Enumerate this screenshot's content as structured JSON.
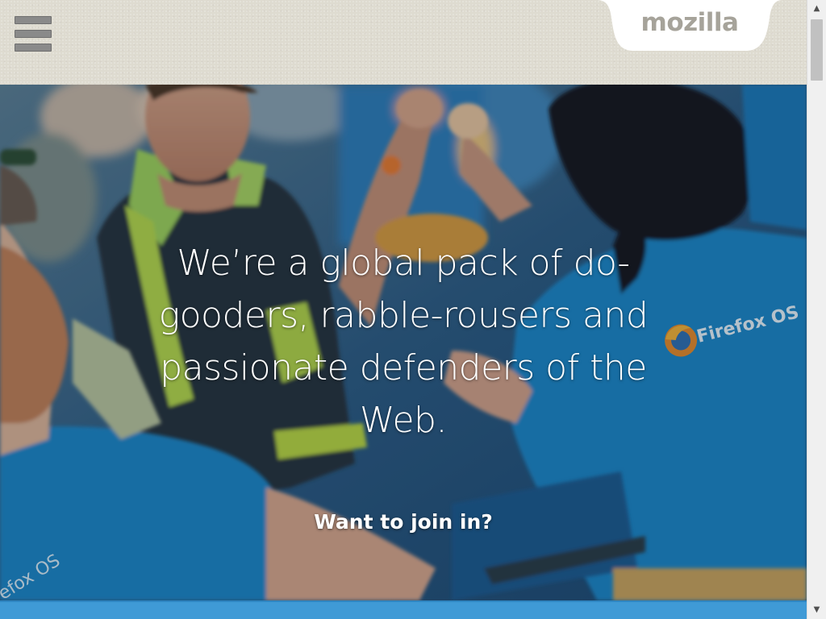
{
  "header": {
    "menu_icon": "hamburger-menu-icon",
    "logo_text": "mozilla"
  },
  "hero": {
    "headline": "We’re a global pack of do-gooders, rabble-rousers and passionate defenders of the Web.",
    "cta": "Want to join in?",
    "shirt_text_right": "Firefox OS",
    "shirt_text_left": "efox OS"
  },
  "scrollbar": {
    "up_icon": "scroll-up-arrow-icon",
    "down_icon": "scroll-down-arrow-icon",
    "position_fraction": 0.0
  },
  "colors": {
    "header_bg": "#dedbd0",
    "logo_tab_bg": "#ffffff",
    "logo_text": "#a6a39a",
    "hero_tint": "#1d4f78",
    "shirt_blue": "#1f86c6",
    "bottom_strip": "#3f9ad6"
  }
}
